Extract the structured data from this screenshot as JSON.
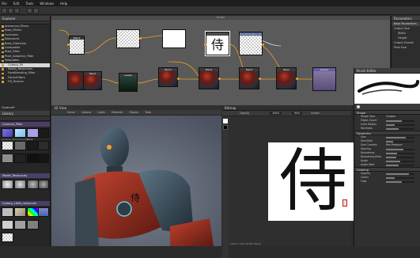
{
  "menu": [
    "File",
    "Edit",
    "Tools",
    "Windows",
    "Help"
  ],
  "explorer": {
    "title": "Explorer",
    "items": [
      "Advanced_Filters",
      "Base_Filters",
      "Functions",
      "Resources",
      "Base_Elements",
      "Composite",
      "Pixel_Filter",
      "Pixel_Adaptive_Filter",
      "Templates",
      "Cyborg_Fill",
      "Model_Resources",
      "FaceBlending_Filter",
      "FormsFilters",
      "Fill_Texture"
    ],
    "footer": "Cyronne*"
  },
  "graph": {
    "title": "Graph",
    "nodes": {
      "n_blend1": "Blend",
      "n_transform": "Transformation 2D",
      "n_mask": "Blend",
      "n_blend2": "Blend",
      "n_blend3": "Blend",
      "n_blend4": "Blend",
      "n_blend5": "Blend",
      "n_output": "Output",
      "n_levels": "Levels",
      "n_base": "Base"
    }
  },
  "params": {
    "title": "Parameters",
    "base_label": "Base Parameters",
    "rows": [
      "Output Size",
      "Width",
      "Height",
      "Output Format",
      "Pixel Size"
    ]
  },
  "library": {
    "title": "Library",
    "sections": [
      "Cyronne_Plain",
      "Model_Resources",
      "Cyborg_LAVA_resources"
    ],
    "labels": [
      "Cyronne_Ov",
      "Cyronne_Ov2",
      "Noise",
      "Fill",
      "Surface",
      "Grunge",
      "Metal",
      "Spark",
      "Rust",
      "Glow",
      "Plate",
      "Tex",
      "Tile"
    ]
  },
  "view3d": {
    "title": "3D View",
    "toolbar": [
      "Scene",
      "Camera",
      "Lights",
      "Materials",
      "Display",
      "Tools"
    ]
  },
  "view2d": {
    "title": "Bitmap",
    "opacity_label": "Opacity",
    "opacity": "100%",
    "status": "1024 x 1024 (8 Bit, Black)",
    "glyph": "侍",
    "zoom_options": [
      "100%",
      "90%",
      "Screen"
    ],
    "toolbar_labels": [
      "Opacity",
      "Levels",
      "Screen",
      "Options"
    ]
  },
  "brush": {
    "title": "Brush Editor",
    "shape_section": "Shape",
    "props_shape": [
      [
        "Shape Type",
        "Custom"
      ],
      [
        "Edges Count",
        ""
      ],
      [
        "Inner Radius",
        ""
      ],
      [
        "Hardness",
        ""
      ]
    ],
    "dynamics_section": "Dynamics",
    "props_dyn": [
      [
        "Size",
        ""
      ],
      [
        "Size Jitter",
        ""
      ],
      [
        "Size Controls",
        "Pen Pressure"
      ],
      [
        "Spacing",
        ""
      ],
      [
        "Roundness",
        ""
      ],
      [
        "Roundness Jitter",
        ""
      ],
      [
        "Angle",
        ""
      ],
      [
        "Angle Jitter",
        ""
      ]
    ],
    "color_section": "Coloring",
    "props_color": [
      [
        "Opacity",
        ""
      ],
      [
        "Colors",
        ""
      ],
      [
        "Flow",
        ""
      ]
    ],
    "slider_levels": [
      0.55,
      0.3,
      0.45,
      0.7,
      0.25,
      0.6,
      0.4,
      0.35,
      0.5,
      0.45,
      0.8,
      0.3
    ]
  },
  "colors": {
    "accent": "#f0a020",
    "library_section": "#4b3f67",
    "background": "#2b2b2b"
  }
}
